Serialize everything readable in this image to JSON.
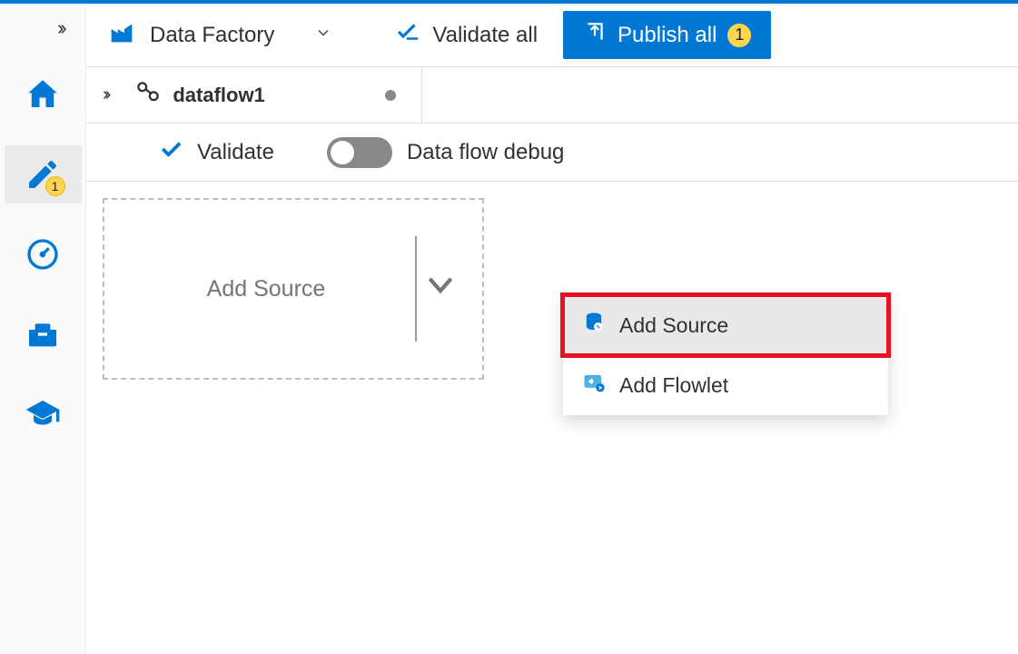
{
  "header": {
    "factory_label": "Data Factory",
    "validate_all_label": "Validate all",
    "publish_label": "Publish all",
    "publish_count": "1"
  },
  "left_rail": {
    "pencil_badge": "1"
  },
  "tab": {
    "name": "dataflow1"
  },
  "toolbar": {
    "validate_label": "Validate",
    "debug_label": "Data flow debug"
  },
  "canvas": {
    "add_source_label": "Add Source"
  },
  "dropdown": {
    "add_source_label": "Add Source",
    "add_flowlet_label": "Add Flowlet"
  }
}
